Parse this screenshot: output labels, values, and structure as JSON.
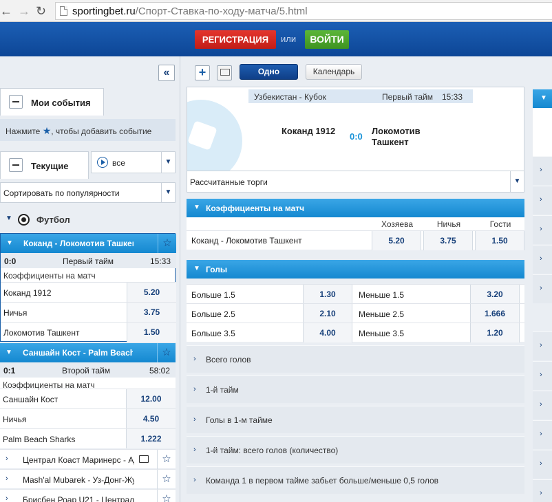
{
  "browser": {
    "url_host": "sportingbet.ru",
    "url_path": "/Спорт-Ставка-по-ходу-матча/5.html",
    "back_icon": "arrow-left-icon",
    "forward_icon": "arrow-right-icon",
    "reload_icon": "reload-icon"
  },
  "header": {
    "register_label": "РЕГИСТРАЦИЯ",
    "or_label": "или",
    "login_label": "ВОЙТИ"
  },
  "sidebar": {
    "collapse_icon": "«",
    "my_events_label": "Мои события",
    "hint_before": "Нажмите ",
    "hint_after": ", чтобы добавить событие",
    "current_label": "Текущие",
    "filter_value": "все",
    "sort_value": "Сортировать по популярности",
    "sport_label": "Футбол",
    "matches": [
      {
        "title": "Коканд - Локомотив Ташкент",
        "score": "0:0",
        "period": "Первый тайм",
        "time": "15:33",
        "odds_title": "Коэффициенты на матч",
        "odds": [
          {
            "name": "Коканд 1912",
            "value": "5.20"
          },
          {
            "name": "Ничья",
            "value": "3.75"
          },
          {
            "name": "Локомотив Ташкент",
            "value": "1.50"
          }
        ]
      },
      {
        "title": "Саншайн Кост - Palm Beach Sharks",
        "score": "0:1",
        "period": "Второй тайм",
        "time": "58:02",
        "odds_title": "Коэффициенты на матч",
        "odds": [
          {
            "name": "Саншайн Кост",
            "value": "12.00"
          },
          {
            "name": "Ничья",
            "value": "4.50"
          },
          {
            "name": "Palm Beach Sharks",
            "value": "1.222"
          }
        ]
      }
    ],
    "other_matches": [
      {
        "name": "Централ Коаст Маринерс - Аделаида"
      },
      {
        "name": "Mash'al Mubarek - Уз-Донг-Жу"
      },
      {
        "name": "Брисбен Роар U21 - Централ"
      }
    ]
  },
  "main": {
    "plus_label": "+",
    "tab_one": "Одно",
    "tab_calendar": "Календарь",
    "event": {
      "league": "Узбекистан - Кубок",
      "period": "Первый тайм",
      "time": "15:33",
      "home": "Коканд 1912",
      "score": "0:0",
      "away_line1": "Локомотив",
      "away_line2": "Ташкент"
    },
    "markets_select": "Рассчитанные торги",
    "match_odds": {
      "title": "Коэффициенты на матч",
      "col_home": "Хозяева",
      "col_draw": "Ничья",
      "col_away": "Гости",
      "row_name": "Коканд - Локомотив Ташкент",
      "home": "5.20",
      "draw": "3.75",
      "away": "1.50"
    },
    "goals": {
      "title": "Голы",
      "rows": [
        {
          "over_label": "Больше  1.5",
          "over": "1.30",
          "under_label": "Меньше  1.5",
          "under": "3.20"
        },
        {
          "over_label": "Больше  2.5",
          "over": "2.10",
          "under_label": "Меньше  2.5",
          "under": "1.666"
        },
        {
          "over_label": "Больше  3.5",
          "over": "4.00",
          "under_label": "Меньше  3.5",
          "under": "1.20"
        }
      ]
    },
    "markets": [
      "Всего голов",
      "1-й тайм",
      "Голы в 1-м тайме",
      "1-й тайм: всего голов (количество)",
      "Команда 1 в первом тайме забьет больше/меньше 0,5 голов"
    ]
  }
}
